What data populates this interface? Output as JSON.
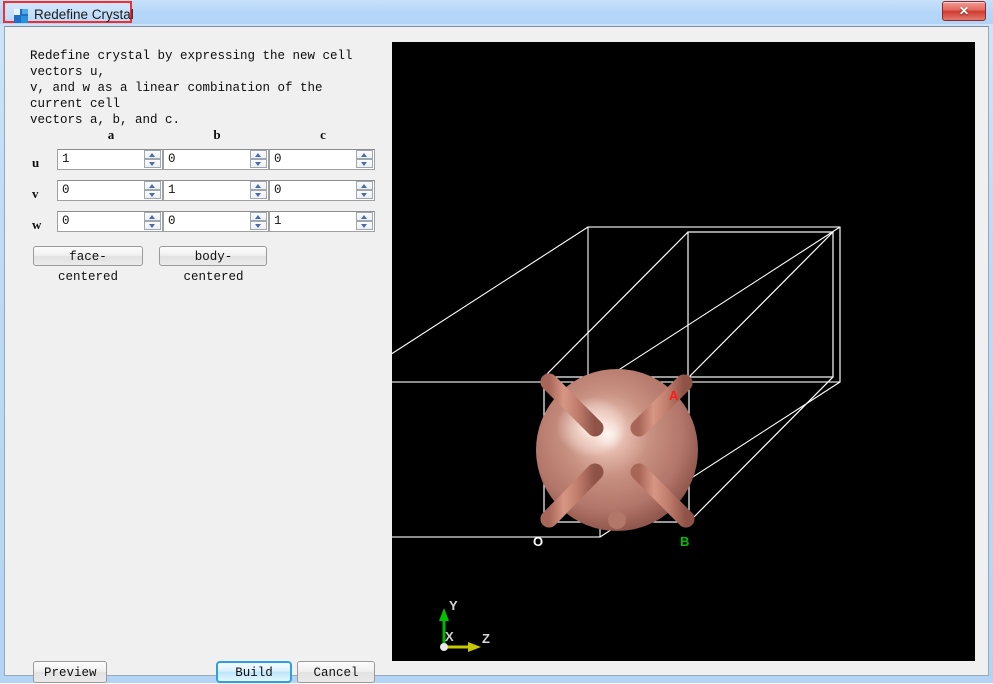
{
  "window": {
    "title": "Redefine Crystal",
    "app_icon": "app-logo-icon",
    "close_label": "✕",
    "title_highlight_color": "#f42c2c",
    "titlebar_color": "#b5d6f8"
  },
  "panel": {
    "description": "Redefine crystal by expressing the new  cell vectors u,\nv, and w as a linear combination of the current cell\nvectors a, b, and c."
  },
  "matrix": {
    "column_headers": [
      "a",
      "b",
      "c"
    ],
    "rows": [
      {
        "label": "u",
        "values": [
          "1",
          "0",
          "0"
        ]
      },
      {
        "label": "v",
        "values": [
          "0",
          "1",
          "0"
        ]
      },
      {
        "label": "w",
        "values": [
          "0",
          "0",
          "1"
        ]
      }
    ],
    "spinner_up_icon": "chevron-up-icon",
    "spinner_down_icon": "chevron-down-icon"
  },
  "centering": {
    "face_centered_label": "face-centered",
    "body_centered_label": "body-centered"
  },
  "actions": {
    "preview_label": "Preview",
    "build_label": "Build",
    "cancel_label": "Cancel",
    "default_button": "Build",
    "default_button_border_color": "#2f9fe0"
  },
  "viewport": {
    "background_color": "#000000",
    "cell_edge_color": "#ffffff",
    "atom_color": "#c08070",
    "bond_color": "#c07a68",
    "labels": {
      "origin": {
        "text": "O",
        "color": "#ffffff"
      },
      "a_axis": {
        "text": "A",
        "color": "#ff1a1a"
      },
      "b_axis": {
        "text": "B",
        "color": "#00c000"
      }
    },
    "axis_indicator": {
      "x": {
        "text": "X",
        "color": "#ffffff"
      },
      "y": {
        "text": "Y",
        "color": "#00c000"
      },
      "z": {
        "text": "Z",
        "color": "#c8c800"
      }
    }
  }
}
